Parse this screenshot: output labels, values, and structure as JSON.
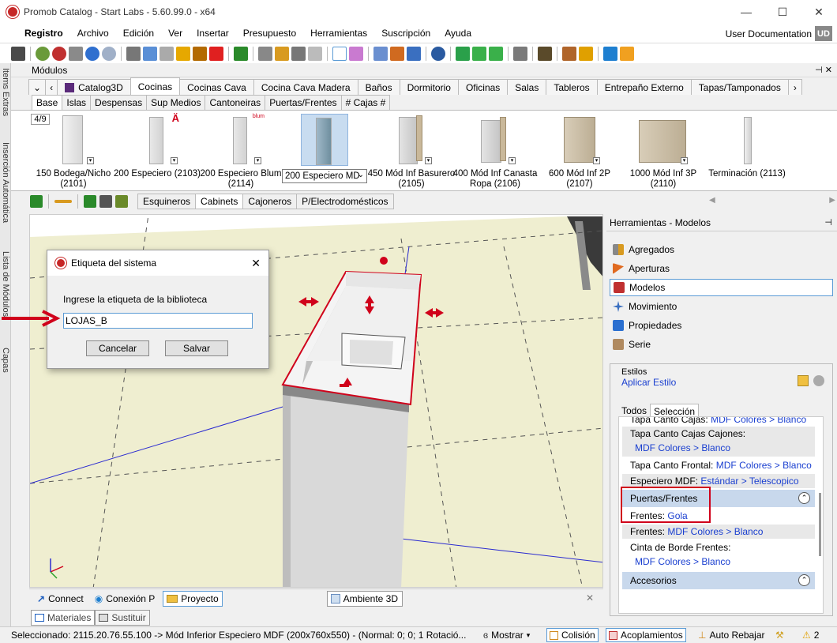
{
  "window": {
    "title": "Promob Catalog - Start Labs - 5.60.99.0 - x64",
    "minimize": "—",
    "maximize": "☐",
    "close": "✕"
  },
  "menu": {
    "items": [
      "Registro",
      "Archivo",
      "Edición",
      "Ver",
      "Insertar",
      "Presupuesto",
      "Herramientas",
      "Suscripción",
      "Ayuda"
    ],
    "user_doc": "User Documentation",
    "user_initials": "UD"
  },
  "left_strip": {
    "tabs": [
      "Items Extras",
      "Inserción Automática",
      "Lista de Módulos",
      "Capas"
    ]
  },
  "modules": {
    "header": "Módulos",
    "pin": "⊣ ✕",
    "category_tabs": [
      "Catalog3D",
      "Cocinas",
      "Cocinas Cava",
      "Cocina Cava Madera",
      "Baños",
      "Dormitorio",
      "Oficinas",
      "Salas",
      "Tableros",
      "Entrepaño Externo",
      "Tapas/Tamponados"
    ],
    "active_category": "Cocinas",
    "sub_tabs": [
      "Base",
      "Islas",
      "Despensas",
      "Sup Medios",
      "Cantoneiras",
      "Puertas/Frentes",
      "# Cajas #"
    ],
    "active_sub": "Base",
    "pager": "4/9",
    "items": [
      {
        "label": "150 Bodega/Nicho\n(2101)"
      },
      {
        "label": "200 Especiero (2103)"
      },
      {
        "label": "200 Especiero Blum\n(2114)"
      },
      {
        "label": "200 Especiero MD"
      },
      {
        "label": "450 Mód Inf Basurero\n(2105)"
      },
      {
        "label": "400 Mód Inf Canasta\nRopa (2106)"
      },
      {
        "label": "600 Mód Inf 2P\n(2107)"
      },
      {
        "label": "1000 Mód Inf 3P\n(2110)"
      },
      {
        "label": "Terminación (2113)"
      }
    ],
    "new_badge": "Ä",
    "blum_badge": "blum"
  },
  "toolbar2": {
    "tabs": [
      "Esquineros",
      "Cabinets",
      "Cajoneros",
      "P/Electrodomésticos"
    ],
    "active": "Cabinets"
  },
  "bottom": {
    "tabs": [
      "Connect",
      "Conexión P",
      "Proyecto",
      "Ambiente 3D"
    ],
    "close": "✕",
    "materials_tabs": [
      "Materiales",
      "Sustituir"
    ]
  },
  "status": {
    "selection": "Seleccionado: 2115.20.76.55.100 -> Mód Inferior Especiero MDF (200x760x550) - (Normal: 0; 0; 1 Rotació...",
    "mostrar": "Mostrar",
    "colision": "Colisión",
    "acoplamientos": "Acoplamientos",
    "auto_rebajar": "Auto Rebajar",
    "warnings": "2"
  },
  "right_panel": {
    "header": "Herramientas - Modelos",
    "pin": "⊣",
    "items": [
      "Agregados",
      "Aperturas",
      "Modelos",
      "Movimiento",
      "Propiedades",
      "Serie"
    ],
    "selected": "Modelos",
    "estilos_label": "Estilos",
    "aplicar_estilo": "Aplicar Estilo",
    "tabs": [
      "Todos",
      "Selección"
    ],
    "active_tab": "Selección",
    "props": {
      "tapa_canto_cajas_label": "Tapa Canto Cajas:",
      "tapa_canto_cajas_value": "MDF Colores > Blanco",
      "tapa_canto_cajas_cajones_label": "Tapa Canto Cajas Cajones:",
      "tapa_canto_cajas_cajones_value": "MDF Colores > Blanco",
      "tapa_canto_frontal_label": "Tapa Canto Frontal:",
      "tapa_canto_frontal_value": "MDF Colores > Blanco",
      "especiero_label": "Especiero MDF:",
      "especiero_value": "Estándar > Telescopico",
      "group_puertas": "Puertas/Frentes",
      "frentes1_label": "Frentes:",
      "frentes1_value": "Gola",
      "frentes2_label": "Frentes:",
      "frentes2_value": "MDF Colores > Blanco",
      "cinta_label": "Cinta de Borde Frentes:",
      "cinta_value": "MDF Colores > Blanco",
      "group_accesorios": "Accesorios"
    }
  },
  "dialog": {
    "title": "Etiqueta del sistema",
    "prompt": "Ingrese la etiqueta de la biblioteca",
    "input_value": "LOJAS_B",
    "cancel": "Cancelar",
    "save": "Salvar"
  },
  "colors": {
    "accent_blue": "#5b9bd5",
    "highlight_red": "#d0021b",
    "floor": "#efeed0",
    "link_blue": "#1a3fd0"
  }
}
